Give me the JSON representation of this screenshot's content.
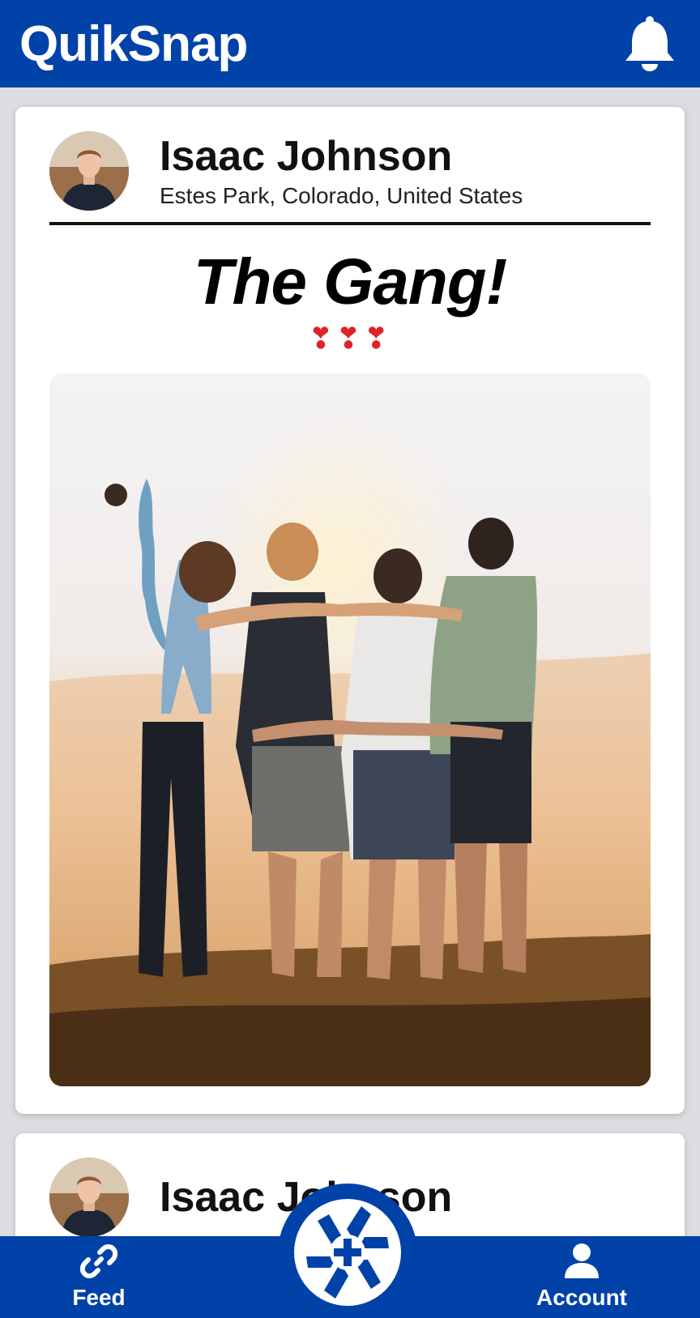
{
  "header": {
    "app_title": "QuikSnap",
    "notification_icon": "bell-icon"
  },
  "posts": [
    {
      "user_name": "Isaac Johnson",
      "location": "Estes Park, Colorado, United States",
      "title": "The Gang!",
      "reactions": "❣❣❣"
    },
    {
      "user_name": "Isaac Johnson"
    }
  ],
  "nav": {
    "feed_label": "Feed",
    "feed_icon": "link-icon",
    "capture_icon": "camera-shutter-plus-icon",
    "account_label": "Account",
    "account_icon": "person-icon"
  },
  "colors": {
    "brand_blue": "#0042a8",
    "heart_red": "#e0232a"
  }
}
